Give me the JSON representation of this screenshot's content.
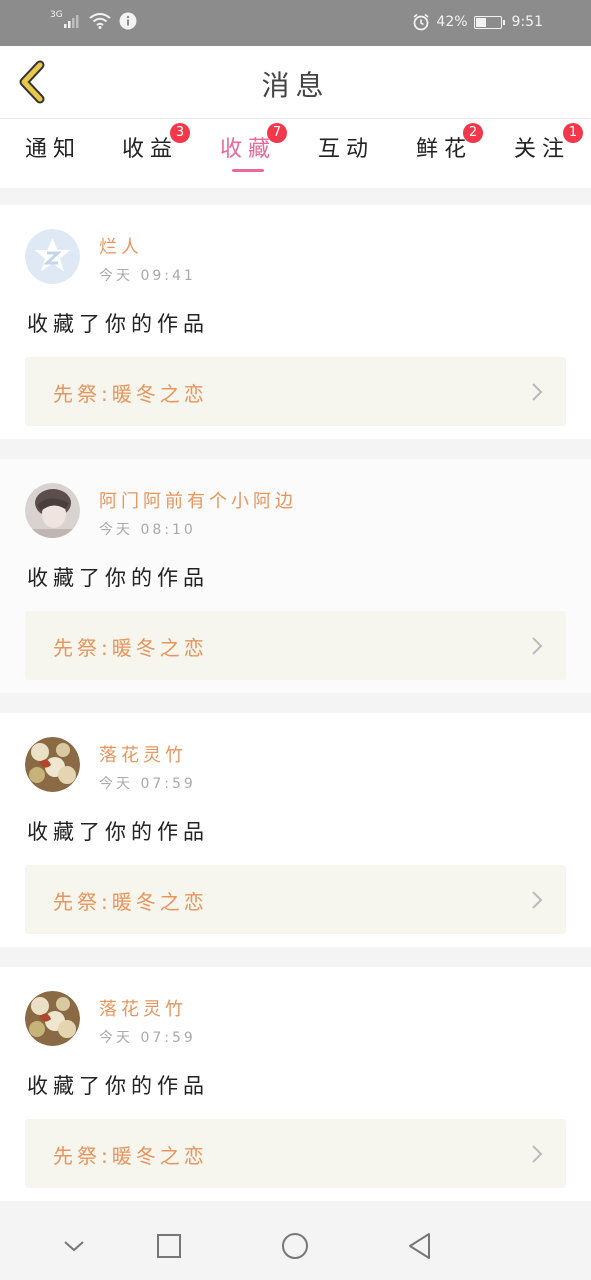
{
  "status_bar": {
    "network": "3G",
    "battery_percent": "42%",
    "battery_level": 0.42,
    "time": "9:51",
    "icons": [
      "signal-icon",
      "wifi-icon",
      "info-icon",
      "alarm-icon",
      "battery-icon"
    ]
  },
  "header": {
    "title": "消息",
    "back_icon": "chevron-left-icon"
  },
  "tabs": [
    {
      "label": "通知",
      "badge": ""
    },
    {
      "label": "收益",
      "badge": "3"
    },
    {
      "label": "收藏",
      "badge": "7",
      "active": true
    },
    {
      "label": "互动",
      "badge": ""
    },
    {
      "label": "鲜花",
      "badge": "2"
    },
    {
      "label": "关注",
      "badge": "1"
    }
  ],
  "messages": [
    {
      "name": "烂人",
      "time": "今天  09:41",
      "action": "收藏了你的作品",
      "work": "先祭:暖冬之恋"
    },
    {
      "name": "阿门阿前有个小阿边",
      "time": "今天  08:10",
      "action": "收藏了你的作品",
      "work": "先祭:暖冬之恋"
    },
    {
      "name": "落花灵竹",
      "time": "今天  07:59",
      "action": "收藏了你的作品",
      "work": "先祭:暖冬之恋"
    },
    {
      "name": "落花灵竹",
      "time": "今天  07:59",
      "action": "收藏了你的作品",
      "work": "先祭:暖冬之恋"
    }
  ],
  "colors": {
    "accent": "#e86a9a",
    "name": "#e8955c",
    "badge": "#f2384a",
    "work_bg": "#f6f5ee",
    "back": "#e8c84a"
  },
  "nav_icons": [
    "chevron-down-icon",
    "square-icon",
    "circle-home-icon",
    "triangle-back-icon"
  ]
}
